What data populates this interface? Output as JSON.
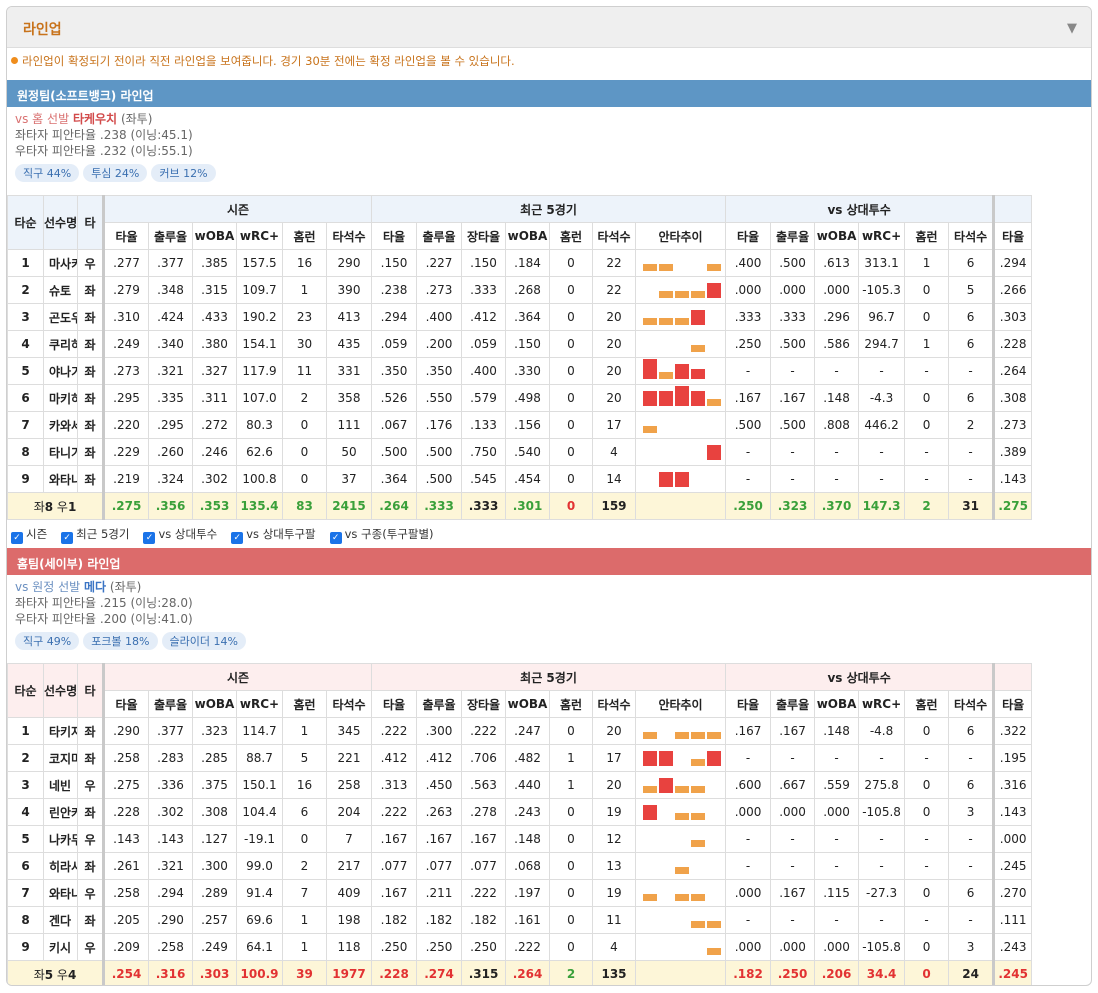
{
  "header": {
    "title": "라인업",
    "notice": "라인업이 확정되기 전이라 직전 라인업을 보여줍니다. 경기 30분 전에는 확정 라인업을 볼 수 있습니다."
  },
  "columns": {
    "order": "타순",
    "name": "선수명",
    "hand": "타",
    "season": "시즌",
    "recent": "최근 5경기",
    "vs_pitcher": "vs 상대투수",
    "avg": "타율",
    "obp": "출루율",
    "slg": "장타율",
    "woba": "wOBA",
    "wrc": "wRC+",
    "hr": "홈런",
    "ab": "타석수",
    "trend": "안타추이"
  },
  "checks": [
    "시즌",
    "최근 5경기",
    "vs 상대투수",
    "vs 상대투구팔",
    "vs 구종(투구팔별)"
  ],
  "colors": {
    "away": "#5e96c5",
    "home": "#dc6b6b",
    "good": "#3aa03a",
    "bad": "#e23232",
    "spark_hit": "#e8423f",
    "spark_out": "#f0a24a"
  },
  "away": {
    "title": "원정팀(소프트뱅크) 라인업",
    "vs_text": "vs 홈 선발",
    "pitcher": "타케우치",
    "hand": "(좌투)",
    "lhb": "좌타자 피안타율 .238 (이닝:45.1)",
    "rhb": "우타자 피안타율 .232 (이닝:55.1)",
    "pills": [
      "직구 44%",
      "투심 24%",
      "커브 12%"
    ],
    "rows": [
      {
        "o": "1",
        "n": "마사키",
        "h": "우",
        "s": [
          ".277",
          ".377",
          ".385",
          "157.5",
          "16",
          "290"
        ],
        "r": [
          ".150",
          ".227",
          ".150",
          ".184",
          "0",
          "22"
        ],
        "t": [
          1,
          1,
          0,
          0,
          1
        ],
        "v": [
          ".400",
          ".500",
          ".613",
          "313.1",
          "1",
          "6"
        ],
        "x": ".294"
      },
      {
        "o": "2",
        "n": "슈토",
        "h": "좌",
        "s": [
          ".279",
          ".348",
          ".315",
          "109.7",
          "1",
          "390"
        ],
        "r": [
          ".238",
          ".273",
          ".333",
          ".268",
          "0",
          "22"
        ],
        "t": [
          0,
          1,
          1,
          1,
          3
        ],
        "v": [
          ".000",
          ".000",
          ".000",
          "-105.3",
          "0",
          "5"
        ],
        "x": ".266"
      },
      {
        "o": "3",
        "n": "곤도우",
        "h": "좌",
        "s": [
          ".310",
          ".424",
          ".433",
          "190.2",
          "23",
          "413"
        ],
        "r": [
          ".294",
          ".400",
          ".412",
          ".364",
          "0",
          "20"
        ],
        "t": [
          1,
          1,
          1,
          3,
          0
        ],
        "v": [
          ".333",
          ".333",
          ".296",
          "96.7",
          "0",
          "6"
        ],
        "x": ".303"
      },
      {
        "o": "4",
        "n": "쿠리하라",
        "h": "좌",
        "s": [
          ".249",
          ".340",
          ".380",
          "154.1",
          "30",
          "435"
        ],
        "r": [
          ".059",
          ".200",
          ".059",
          ".150",
          "0",
          "20"
        ],
        "t": [
          0,
          0,
          0,
          1,
          0
        ],
        "v": [
          ".250",
          ".500",
          ".586",
          "294.7",
          "1",
          "6"
        ],
        "x": ".228"
      },
      {
        "o": "5",
        "n": "야나기타",
        "h": "좌",
        "s": [
          ".273",
          ".321",
          ".327",
          "117.9",
          "11",
          "331"
        ],
        "r": [
          ".350",
          ".350",
          ".400",
          ".330",
          "0",
          "20"
        ],
        "t": [
          4,
          1,
          3,
          2,
          0
        ],
        "v": [
          "-",
          "-",
          "-",
          "-",
          "-",
          "-"
        ],
        "x": ".264"
      },
      {
        "o": "6",
        "n": "마키하라",
        "h": "좌",
        "s": [
          ".295",
          ".335",
          ".311",
          "107.0",
          "2",
          "358"
        ],
        "r": [
          ".526",
          ".550",
          ".579",
          ".498",
          "0",
          "20"
        ],
        "t": [
          3,
          3,
          4,
          3,
          1
        ],
        "v": [
          ".167",
          ".167",
          ".148",
          "-4.3",
          "0",
          "6"
        ],
        "x": ".308"
      },
      {
        "o": "7",
        "n": "카와세",
        "h": "좌",
        "s": [
          ".220",
          ".295",
          ".272",
          "80.3",
          "0",
          "111"
        ],
        "r": [
          ".067",
          ".176",
          ".133",
          ".156",
          "0",
          "17"
        ],
        "t": [
          1,
          0,
          0,
          0,
          0
        ],
        "v": [
          ".500",
          ".500",
          ".808",
          "446.2",
          "0",
          "2"
        ],
        "x": ".273"
      },
      {
        "o": "8",
        "n": "타니가와라",
        "h": "좌",
        "s": [
          ".229",
          ".260",
          ".246",
          "62.6",
          "0",
          "50"
        ],
        "r": [
          ".500",
          ".500",
          ".750",
          ".540",
          "0",
          "4"
        ],
        "t": [
          0,
          0,
          0,
          0,
          3
        ],
        "v": [
          "-",
          "-",
          "-",
          "-",
          "-",
          "-"
        ],
        "x": ".389"
      },
      {
        "o": "9",
        "n": "와타나베",
        "h": "좌",
        "s": [
          ".219",
          ".324",
          ".302",
          "100.8",
          "0",
          "37"
        ],
        "r": [
          ".364",
          ".500",
          ".545",
          ".454",
          "0",
          "14"
        ],
        "t": [
          0,
          3,
          3,
          0,
          0
        ],
        "v": [
          "-",
          "-",
          "-",
          "-",
          "-",
          "-"
        ],
        "x": ".143"
      }
    ],
    "total": {
      "label_pre": "좌",
      "l": "8",
      "label_mid": " 우",
      "rr": "1",
      "s": [
        ".275",
        ".356",
        ".353",
        "135.4",
        "83",
        "2415"
      ],
      "r": [
        ".264",
        ".333",
        ".333",
        ".301",
        "0",
        "159"
      ],
      "v": [
        ".250",
        ".323",
        ".370",
        "147.3",
        "2",
        "31"
      ],
      "x": ".275"
    }
  },
  "home": {
    "title": "홈팀(세이부) 라인업",
    "vs_text": "vs 원정 선발",
    "pitcher": "메다",
    "hand": "(좌투)",
    "lhb": "좌타자 피안타율 .215 (이닝:28.0)",
    "rhb": "우타자 피안타율 .200 (이닝:41.0)",
    "pills": [
      "직구 49%",
      "포크볼 18%",
      "슬라이더 14%"
    ],
    "rows": [
      {
        "o": "1",
        "n": "타키자와",
        "h": "좌",
        "s": [
          ".290",
          ".377",
          ".323",
          "114.7",
          "1",
          "345"
        ],
        "r": [
          ".222",
          ".300",
          ".222",
          ".247",
          "0",
          "20"
        ],
        "t": [
          1,
          0,
          1,
          1,
          1
        ],
        "v": [
          ".167",
          ".167",
          ".148",
          "-4.8",
          "0",
          "6"
        ],
        "x": ".322"
      },
      {
        "o": "2",
        "n": "코지마",
        "h": "좌",
        "s": [
          ".258",
          ".283",
          ".285",
          "88.7",
          "5",
          "221"
        ],
        "r": [
          ".412",
          ".412",
          ".706",
          ".482",
          "1",
          "17"
        ],
        "t": [
          3,
          3,
          0,
          1,
          3
        ],
        "v": [
          "-",
          "-",
          "-",
          "-",
          "-",
          "-"
        ],
        "x": ".195"
      },
      {
        "o": "3",
        "n": "네빈",
        "h": "우",
        "s": [
          ".275",
          ".336",
          ".375",
          "150.1",
          "16",
          "258"
        ],
        "r": [
          ".313",
          ".450",
          ".563",
          ".440",
          "1",
          "20"
        ],
        "t": [
          1,
          3,
          1,
          1,
          0
        ],
        "v": [
          ".600",
          ".667",
          ".559",
          "275.8",
          "0",
          "6"
        ],
        "x": ".316"
      },
      {
        "o": "4",
        "n": "린안커",
        "h": "좌",
        "s": [
          ".228",
          ".302",
          ".308",
          "104.4",
          "6",
          "204"
        ],
        "r": [
          ".222",
          ".263",
          ".278",
          ".243",
          "0",
          "19"
        ],
        "t": [
          3,
          0,
          1,
          1,
          0
        ],
        "v": [
          ".000",
          ".000",
          ".000",
          "-105.8",
          "0",
          "3"
        ],
        "x": ".143"
      },
      {
        "o": "5",
        "n": "나카무라",
        "h": "우",
        "s": [
          ".143",
          ".143",
          ".127",
          "-19.1",
          "0",
          "7"
        ],
        "r": [
          ".167",
          ".167",
          ".167",
          ".148",
          "0",
          "12"
        ],
        "t": [
          0,
          0,
          0,
          1,
          0
        ],
        "v": [
          "-",
          "-",
          "-",
          "-",
          "-",
          "-"
        ],
        "x": ".000"
      },
      {
        "o": "6",
        "n": "히라사와",
        "h": "좌",
        "s": [
          ".261",
          ".321",
          ".300",
          "99.0",
          "2",
          "217"
        ],
        "r": [
          ".077",
          ".077",
          ".077",
          ".068",
          "0",
          "13"
        ],
        "t": [
          0,
          0,
          1,
          0,
          0
        ],
        "v": [
          "-",
          "-",
          "-",
          "-",
          "-",
          "-"
        ],
        "x": ".245"
      },
      {
        "o": "7",
        "n": "와타나베",
        "h": "우",
        "s": [
          ".258",
          ".294",
          ".289",
          "91.4",
          "7",
          "409"
        ],
        "r": [
          ".167",
          ".211",
          ".222",
          ".197",
          "0",
          "19"
        ],
        "t": [
          1,
          0,
          1,
          1,
          0
        ],
        "v": [
          ".000",
          ".167",
          ".115",
          "-27.3",
          "0",
          "6"
        ],
        "x": ".270"
      },
      {
        "o": "8",
        "n": "겐다",
        "h": "좌",
        "s": [
          ".205",
          ".290",
          ".257",
          "69.6",
          "1",
          "198"
        ],
        "r": [
          ".182",
          ".182",
          ".182",
          ".161",
          "0",
          "11"
        ],
        "t": [
          0,
          0,
          0,
          1,
          1
        ],
        "v": [
          "-",
          "-",
          "-",
          "-",
          "-",
          "-"
        ],
        "x": ".111"
      },
      {
        "o": "9",
        "n": "키시",
        "h": "우",
        "s": [
          ".209",
          ".258",
          ".249",
          "64.1",
          "1",
          "118"
        ],
        "r": [
          ".250",
          ".250",
          ".250",
          ".222",
          "0",
          "4"
        ],
        "t": [
          0,
          0,
          0,
          0,
          1
        ],
        "v": [
          ".000",
          ".000",
          ".000",
          "-105.8",
          "0",
          "3"
        ],
        "x": ".243"
      }
    ],
    "total": {
      "label_pre": "좌",
      "l": "5",
      "label_mid": " 우",
      "rr": "4",
      "s": [
        ".254",
        ".316",
        ".303",
        "100.9",
        "39",
        "1977"
      ],
      "r": [
        ".228",
        ".274",
        ".315",
        ".264",
        "2",
        "135"
      ],
      "v": [
        ".182",
        ".250",
        ".206",
        "34.4",
        "0",
        "24"
      ],
      "x": ".245"
    }
  }
}
